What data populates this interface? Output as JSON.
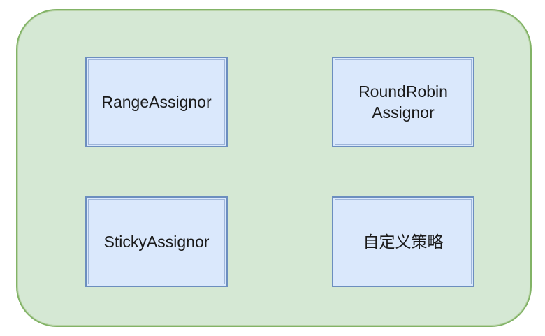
{
  "diagram": {
    "container": {
      "fill_color": "#d5e8d4",
      "border_color": "#82b366"
    },
    "nodes": [
      {
        "label": "RangeAssignor"
      },
      {
        "label": "RoundRobin\nAssignor"
      },
      {
        "label": "StickyAssignor"
      },
      {
        "label": "自定义策略"
      }
    ],
    "node_fill_color": "#dae8fc",
    "node_border_color": "#6c8ebf"
  }
}
